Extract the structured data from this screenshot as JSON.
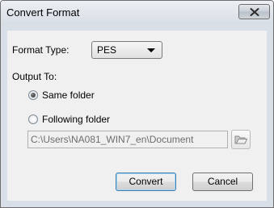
{
  "window": {
    "title": "Convert Format",
    "close_icon": "close-icon"
  },
  "format": {
    "label": "Format Type:",
    "selected": "PES"
  },
  "output": {
    "label": "Output To:",
    "options": [
      {
        "label": "Same folder",
        "checked": true
      },
      {
        "label": "Following folder",
        "checked": false
      }
    ],
    "path": "C:\\Users\\NA081_WIN7_en\\Document",
    "browse_icon": "open-folder-icon"
  },
  "buttons": {
    "convert": "Convert",
    "cancel": "Cancel"
  }
}
